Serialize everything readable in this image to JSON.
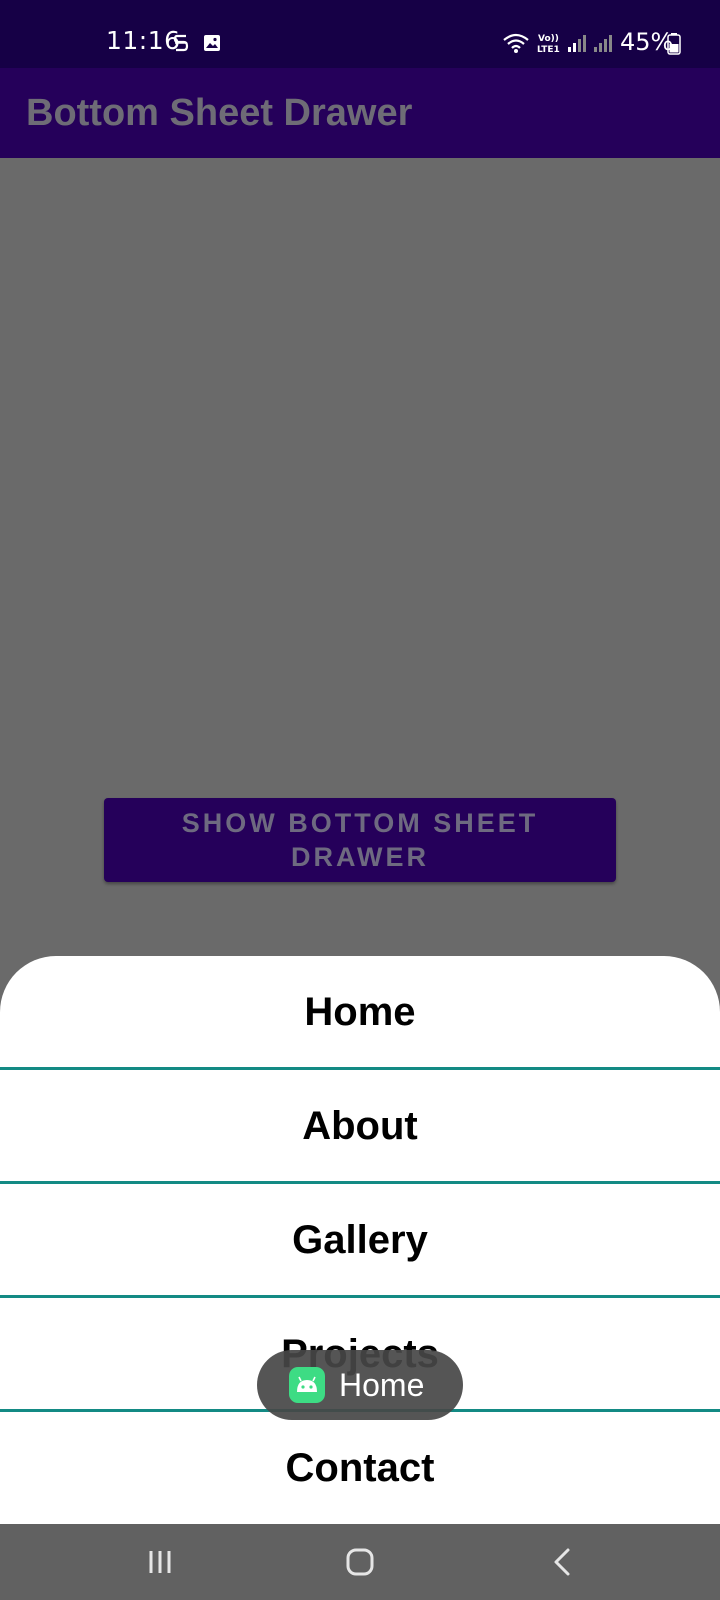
{
  "status_bar": {
    "time": "11:16",
    "battery_percent": "45%",
    "icons": [
      "s-icon",
      "image-icon",
      "wifi-icon",
      "volte-icon",
      "signal-icon",
      "signal-icon",
      "battery-icon"
    ]
  },
  "app_bar": {
    "title": "Bottom Sheet Drawer"
  },
  "main": {
    "show_button_label": "SHOW BOTTOM SHEET DRAWER"
  },
  "sheet": {
    "items": [
      {
        "label": "Home"
      },
      {
        "label": "About"
      },
      {
        "label": "Gallery"
      },
      {
        "label": "Projects"
      },
      {
        "label": "Contact"
      }
    ],
    "divider_color": "#138a84"
  },
  "toast": {
    "text": "Home",
    "icon": "android-icon"
  },
  "nav_bar": {
    "icons": [
      "recents-icon",
      "home-icon",
      "back-icon"
    ]
  },
  "colors": {
    "status_bar": "#160046",
    "app_bar": "#25005a",
    "scrim": "#6a6a6a",
    "nav_bar": "#616161"
  }
}
